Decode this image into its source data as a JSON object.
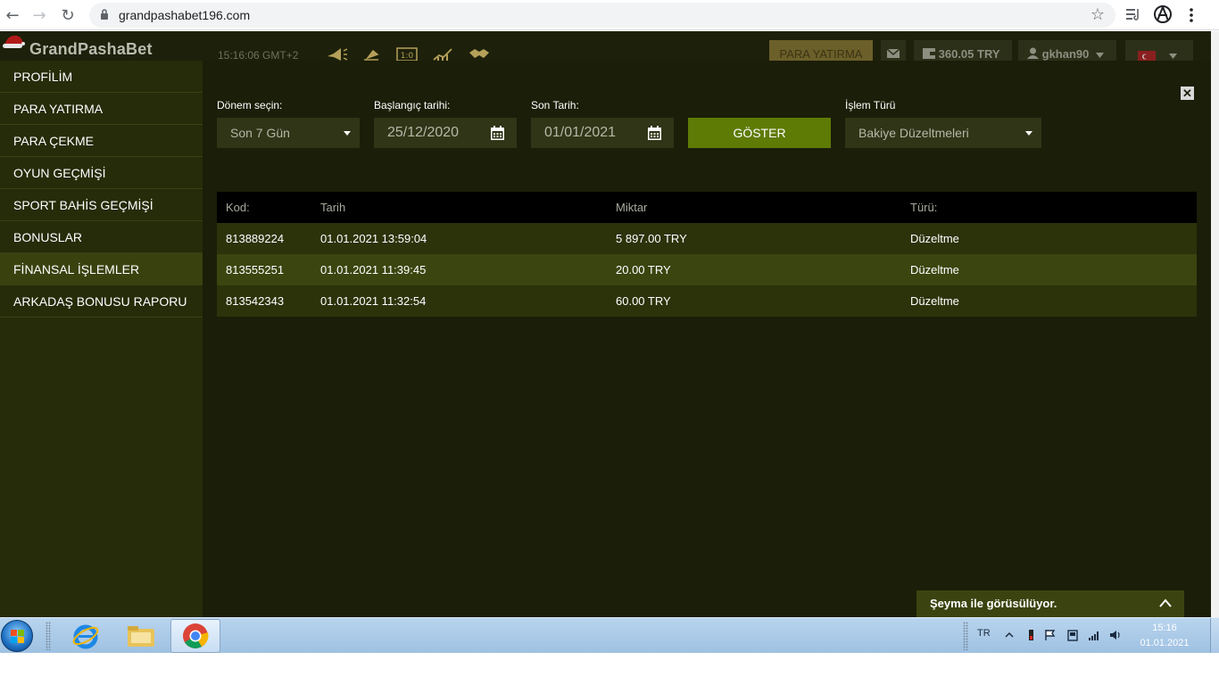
{
  "browser": {
    "url": "grandpashabet196.com",
    "back_icon": "back-arrow-icon",
    "forward_icon": "forward-arrow-icon",
    "reload_icon": "reload-icon",
    "star_icon": "star-icon",
    "nav_glyphs": {
      "back": "←",
      "forward": "→",
      "reload": "↻",
      "star": "☆"
    }
  },
  "header": {
    "logo": "GrandPashaBet",
    "clock": "15:16:06  GMT+2",
    "deposit_label": "PARA YATIRMA",
    "balance": "360.05 TRY",
    "username": "gkhan90"
  },
  "sidebar": {
    "items": [
      {
        "label": "PROFİLİM"
      },
      {
        "label": "PARA YATIRMA"
      },
      {
        "label": "PARA ÇEKME"
      },
      {
        "label": "OYUN GEÇMİŞİ"
      },
      {
        "label": "SPORT BAHİS GEÇMİŞİ"
      },
      {
        "label": "BONUSLAR"
      },
      {
        "label": "FİNANSAL İŞLEMLER",
        "active": true
      },
      {
        "label": "ARKADAŞ BONUSU RAPORU"
      }
    ]
  },
  "filters": {
    "period_label": "Dönem seçin:",
    "period_value": "Son 7 Gün",
    "start_label": "Başlangıç tarihi:",
    "start_value": "25/12/2020",
    "end_label": "Son Tarih:",
    "end_value": "01/01/2021",
    "show_label": "GÖSTER",
    "type_label": "İşlem Türü",
    "type_value": "Bakiye Düzeltmeleri"
  },
  "close_glyph": "✕",
  "table": {
    "headers": [
      "Kod:",
      "Tarih",
      "Miktar",
      "Türü:"
    ],
    "rows": [
      [
        "813889224",
        "01.01.2021 13:59:04",
        "5 897.00 TRY",
        "Düzeltme"
      ],
      [
        "813555251",
        "01.01.2021 11:39:45",
        "20.00 TRY",
        "Düzeltme"
      ],
      [
        "813542343",
        "01.01.2021 11:32:54",
        "60.00 TRY",
        "Düzeltme"
      ]
    ]
  },
  "chat": {
    "label": "Şeyma ile görüsülüyor."
  },
  "taskbar": {
    "language": "TR",
    "time": "15:16",
    "date": "01.01.2021"
  },
  "colors": {
    "page_bg": "#1b1e08",
    "sidebar_bg": "#262b09",
    "accent_green": "#5e7b06",
    "row_odd": "#2c330b",
    "row_even": "#3b4510"
  }
}
